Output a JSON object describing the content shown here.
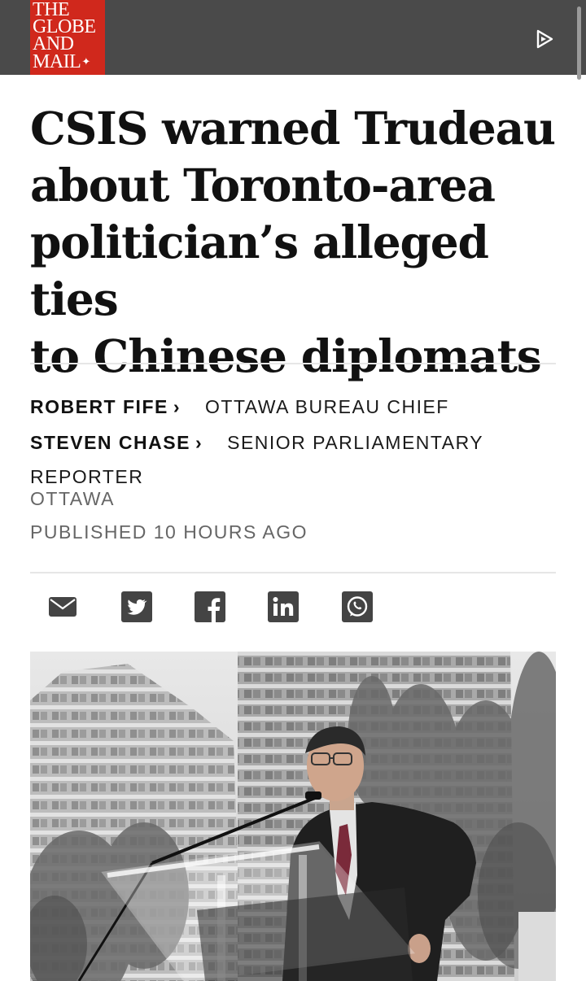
{
  "header": {
    "logo_lines": [
      "THE",
      "GLOBE",
      "AND",
      "MAIL"
    ],
    "logo_mark": "maple-leaf-icon",
    "play_icon": "play-icon",
    "colors": {
      "bar": "#4a4a4a",
      "logo": "#d0281c"
    }
  },
  "article": {
    "headline_lines": [
      "CSIS warned Trudeau",
      "about Toronto-area",
      "politician’s alleged ties",
      "to Chinese diplomats"
    ],
    "bylines": [
      {
        "author": "ROBERT FIFE",
        "role": "OTTAWA BUREAU CHIEF"
      },
      {
        "author": "STEVEN CHASE",
        "role": "SENIOR PARLIAMENTARY",
        "role_cont": "REPORTER"
      }
    ],
    "location": "OTTAWA",
    "published": "PUBLISHED 10 HOURS AGO",
    "chevron": "›"
  },
  "share": {
    "icons": [
      "email-icon",
      "twitter-icon",
      "facebook-icon",
      "linkedin-icon",
      "whatsapp-icon"
    ]
  },
  "hero_image": {
    "subject": "man-speaking-at-podium-photo"
  }
}
